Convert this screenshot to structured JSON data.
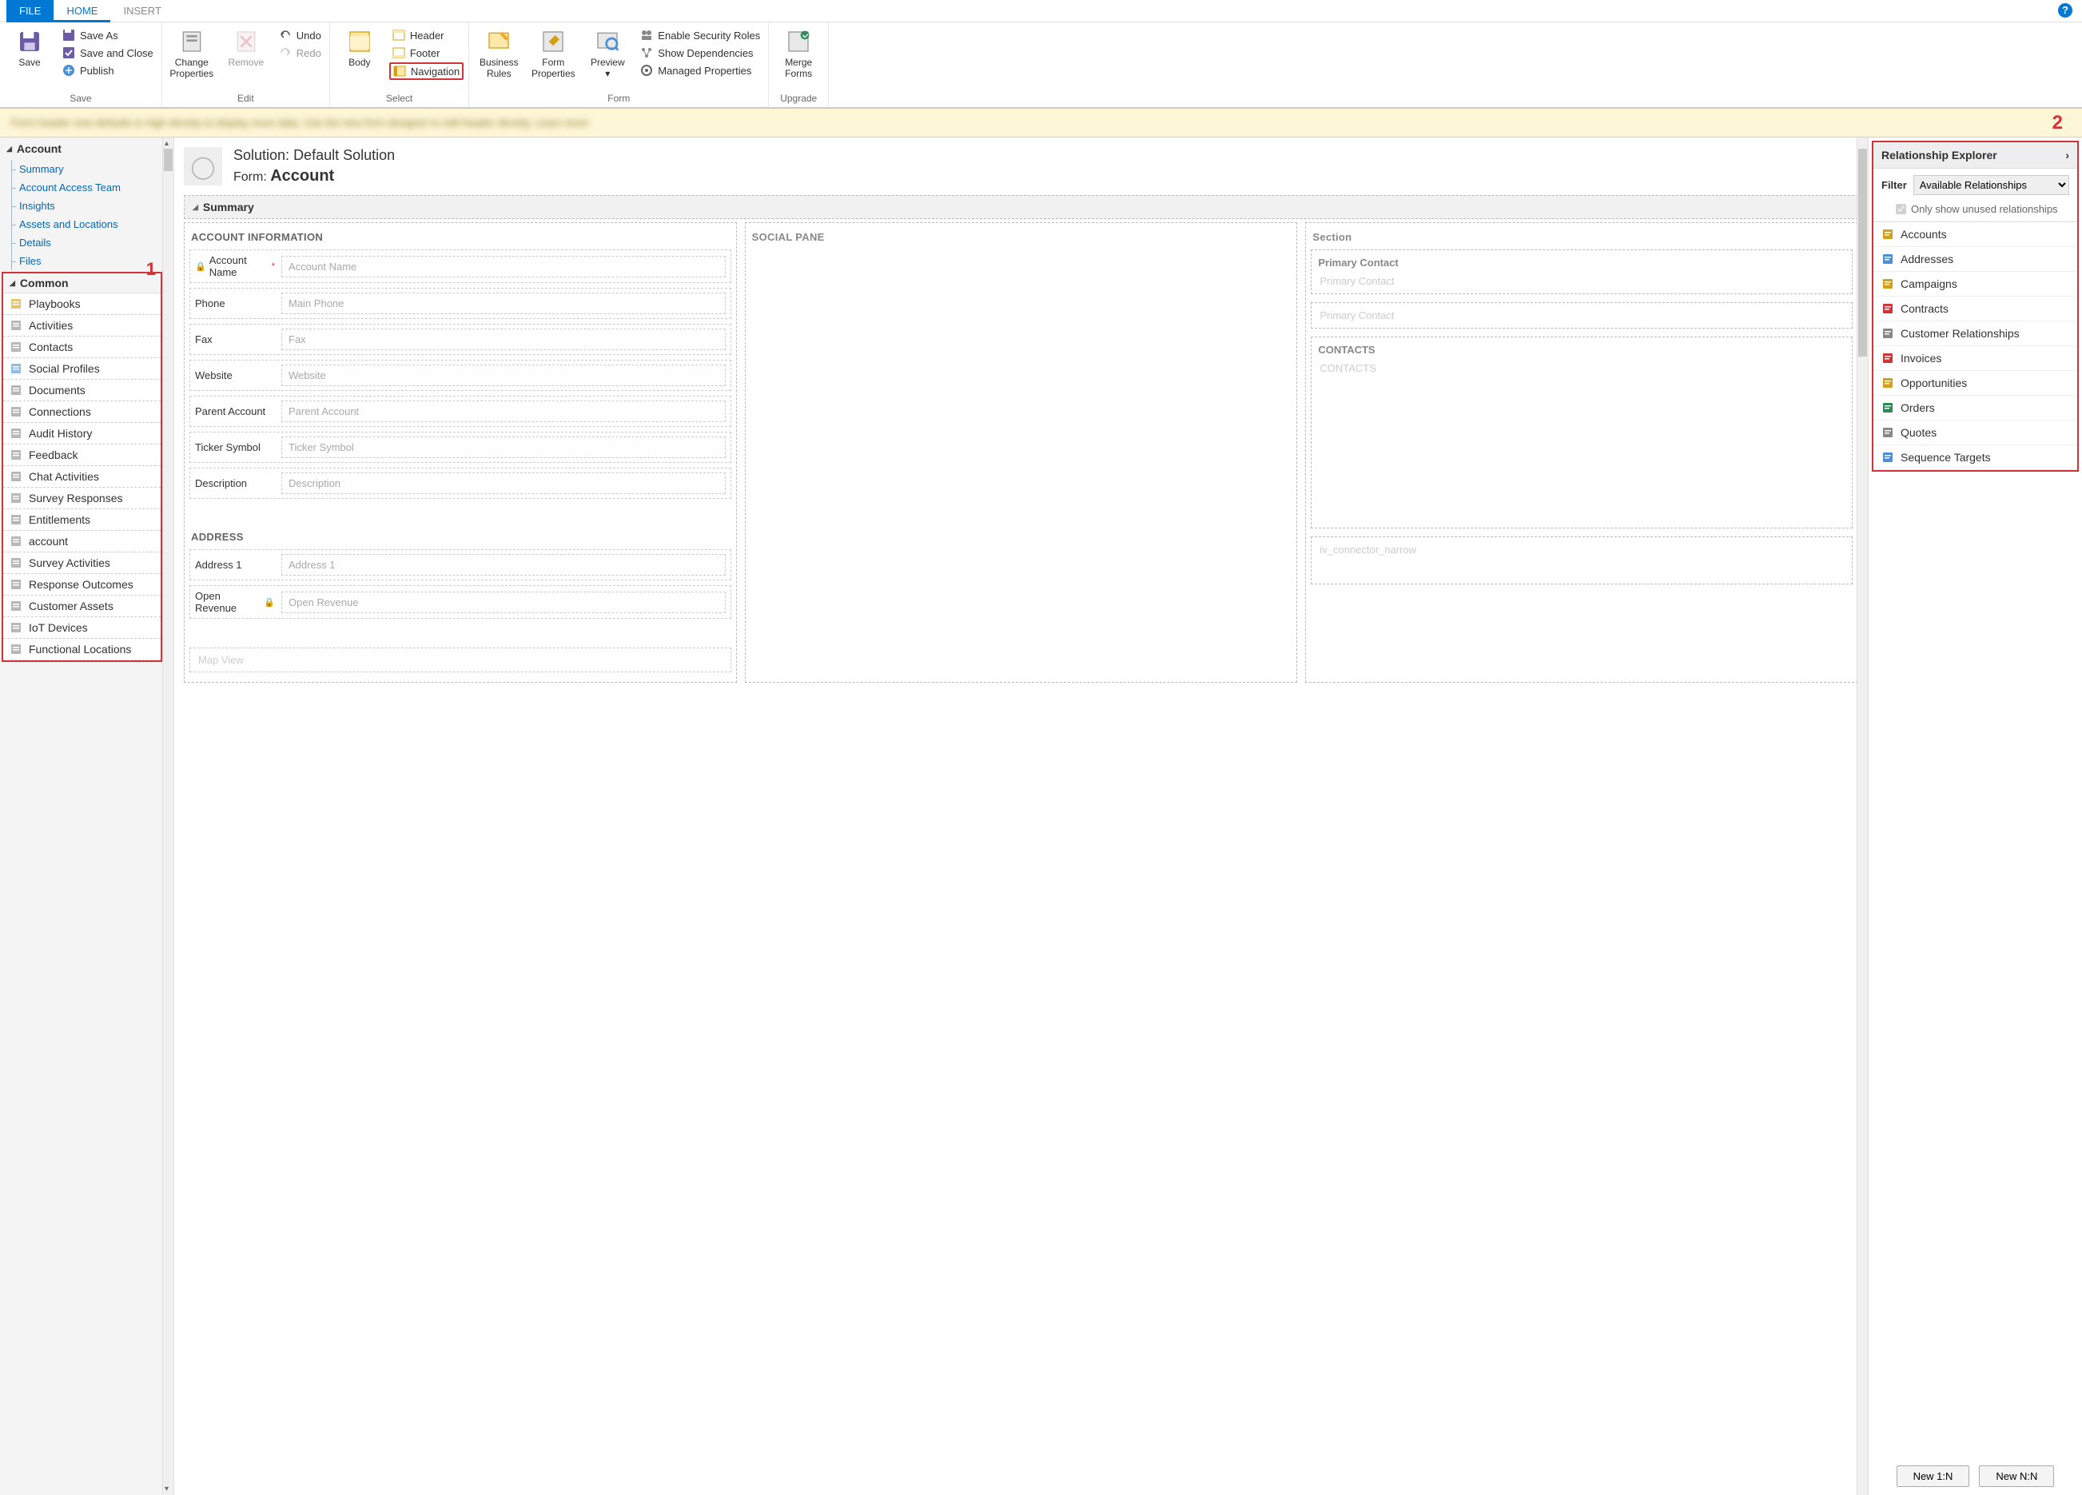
{
  "tabs": {
    "file": "FILE",
    "home": "HOME",
    "insert": "INSERT"
  },
  "ribbon": {
    "save": {
      "big": "Save",
      "saveas": "Save As",
      "saveclose": "Save and Close",
      "publish": "Publish",
      "group": "Save"
    },
    "edit": {
      "change": "Change\nProperties",
      "remove": "Remove",
      "undo": "Undo",
      "redo": "Redo",
      "group": "Edit"
    },
    "select": {
      "body": "Body",
      "header": "Header",
      "footer": "Footer",
      "navigation": "Navigation",
      "group": "Select"
    },
    "form": {
      "bizrules": "Business\nRules",
      "formprops": "Form\nProperties",
      "preview": "Preview",
      "enablesec": "Enable Security Roles",
      "showdeps": "Show Dependencies",
      "managed": "Managed Properties",
      "group": "Form"
    },
    "upgrade": {
      "merge": "Merge\nForms",
      "group": "Upgrade"
    }
  },
  "infobar": "Form header now defaults to high density to display more data. Use the new form designer to edit header density. Learn more",
  "callouts": {
    "one": "1",
    "two": "2"
  },
  "left": {
    "account_hdr": "Account",
    "account_items": [
      "Summary",
      "Account Access Team",
      "Insights",
      "Assets and Locations",
      "Details",
      "Files"
    ],
    "common_hdr": "Common",
    "common_items": [
      "Playbooks",
      "Activities",
      "Contacts",
      "Social Profiles",
      "Documents",
      "Connections",
      "Audit History",
      "Feedback",
      "Chat Activities",
      "Survey Responses",
      "Entitlements",
      "account",
      "Survey Activities",
      "Response Outcomes",
      "Customer Assets",
      "IoT Devices",
      "Functional Locations"
    ]
  },
  "canvas": {
    "solution_label": "Solution: ",
    "solution_name": "Default Solution",
    "form_label": "Form: ",
    "form_name": "Account",
    "summary": "Summary",
    "sections": {
      "acct_info": "ACCOUNT INFORMATION",
      "social": "SOCIAL PANE",
      "section": "Section",
      "address": "ADDRESS",
      "contacts": "CONTACTS",
      "iv": "iv_connector_narrow",
      "mapview": "Map View"
    },
    "fields": {
      "acct_name": {
        "label": "Account Name",
        "ph": "Account Name",
        "required": true,
        "locked": true
      },
      "phone": {
        "label": "Phone",
        "ph": "Main Phone"
      },
      "fax": {
        "label": "Fax",
        "ph": "Fax"
      },
      "website": {
        "label": "Website",
        "ph": "Website"
      },
      "parent": {
        "label": "Parent Account",
        "ph": "Parent Account"
      },
      "ticker": {
        "label": "Ticker Symbol",
        "ph": "Ticker Symbol"
      },
      "desc": {
        "label": "Description",
        "ph": "Description"
      },
      "addr1": {
        "label": "Address 1",
        "ph": "Address 1"
      },
      "openrev": {
        "label": "Open Revenue",
        "ph": "Open Revenue",
        "locked": true
      },
      "primary_contact": {
        "label": "Primary Contact",
        "ph": "Primary Contact"
      },
      "primary_contact2": {
        "ph": "Primary Contact"
      },
      "contacts_ph": "CONTACTS"
    }
  },
  "right": {
    "title": "Relationship Explorer",
    "filter_label": "Filter",
    "filter_value": "Available Relationships",
    "only_unused": "Only show unused relationships",
    "items": [
      "Accounts",
      "Addresses",
      "Campaigns",
      "Contracts",
      "Customer Relationships",
      "Invoices",
      "Opportunities",
      "Orders",
      "Quotes",
      "Sequence Targets"
    ],
    "btn_1n": "New 1:N",
    "btn_nn": "New N:N"
  }
}
